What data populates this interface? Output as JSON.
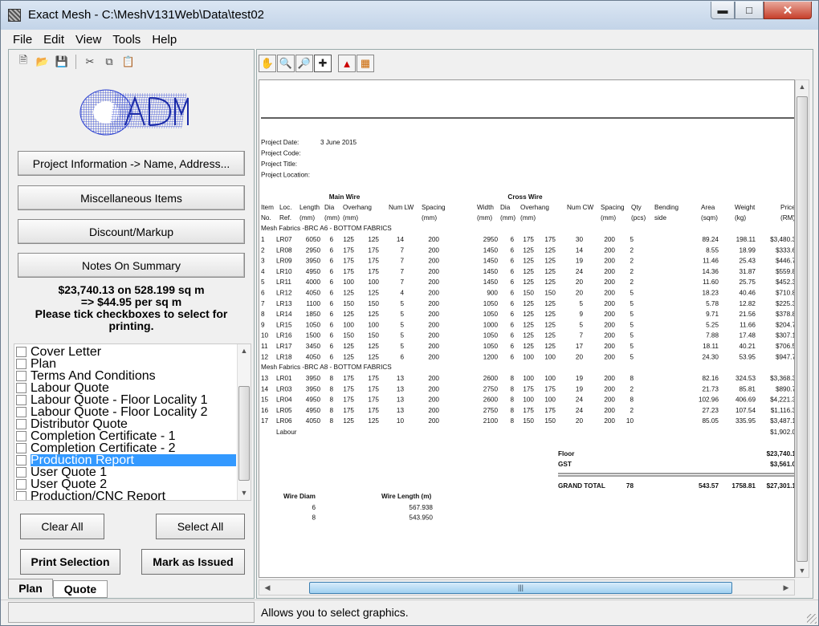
{
  "window": {
    "title": "Exact Mesh - C:\\MeshV131Web\\Data\\test02"
  },
  "menu": [
    "File",
    "Edit",
    "View",
    "Tools",
    "Help"
  ],
  "left": {
    "toolbar": [
      "new-icon",
      "open-icon",
      "save-icon",
      "cut-icon",
      "copy-icon",
      "paste-icon"
    ],
    "buttons": [
      "Project Information -> Name, Address...",
      "Miscellaneous Items",
      "Discount/Markup",
      "Notes On Summary"
    ],
    "summary": [
      "$23,740.13 on 528.199 sq m",
      "=>  $44.95 per sq m",
      "Please tick checkboxes to select for",
      "printing."
    ],
    "documents": [
      "Cover Letter",
      "Plan",
      "Terms And Conditions",
      "Labour Quote",
      "Labour Quote - Floor Locality 1",
      "Labour Quote - Floor Locality 2",
      "Distributor Quote",
      "Completion Certificate - 1",
      "Completion Certificate - 2",
      "Production Report",
      "User Quote 1",
      "User Quote 2",
      "Production/CNC Report"
    ],
    "selected_index": 9,
    "clear_all": "Clear All",
    "select_all": "Select All",
    "print_selection": "Print Selection",
    "mark_as_issued": "Mark as Issued",
    "tabs": [
      "Plan",
      "Quote"
    ],
    "active_tab": "Quote"
  },
  "right": {
    "tools": [
      "hand-icon",
      "zoom-in-icon",
      "zoom-out-icon",
      "crosshair-icon",
      "export-icon",
      "print-graphic-icon"
    ],
    "report": {
      "info": [
        {
          "label": "Project Date:",
          "value": "3 June 2015"
        },
        {
          "label": "Project Code:",
          "value": ""
        },
        {
          "label": "Project Title:",
          "value": ""
        },
        {
          "label": "Project Location:",
          "value": ""
        }
      ],
      "group_main": "Main Wire",
      "group_cross": "Cross Wire",
      "headers1": [
        "Item",
        "Loc.",
        "Length",
        "Dia",
        "Overhang",
        "Num LW",
        "Spacing",
        "Width",
        "Dia",
        "Overhang",
        "Num CW",
        "Spacing",
        "Qty",
        "Bending",
        "Area",
        "Weight",
        "Price"
      ],
      "headers2": [
        "No.",
        "Ref.",
        "(mm)",
        "(mm)",
        "(mm)",
        "",
        "(mm)",
        "(mm)",
        "(mm)",
        "(mm)",
        "",
        "(mm)",
        "(pcs)",
        "side",
        "(sqm)",
        "(kg)",
        "(RM)"
      ],
      "section1": "Mesh Fabrics -BRC A6 - BOTTOM FABRICS",
      "rows1": [
        [
          "1",
          "LR07",
          "6050",
          "6",
          "125",
          "125",
          "14",
          "200",
          "2950",
          "6",
          "175",
          "175",
          "30",
          "200",
          "5",
          "",
          "89.24",
          "198.11",
          "$3,480.3"
        ],
        [
          "2",
          "LR08",
          "2950",
          "6",
          "175",
          "175",
          "7",
          "200",
          "1450",
          "6",
          "125",
          "125",
          "14",
          "200",
          "2",
          "",
          "8.55",
          "18.99",
          "$333.6"
        ],
        [
          "3",
          "LR09",
          "3950",
          "6",
          "175",
          "175",
          "7",
          "200",
          "1450",
          "6",
          "125",
          "125",
          "19",
          "200",
          "2",
          "",
          "11.46",
          "25.43",
          "$446.7"
        ],
        [
          "4",
          "LR10",
          "4950",
          "6",
          "175",
          "175",
          "7",
          "200",
          "1450",
          "6",
          "125",
          "125",
          "24",
          "200",
          "2",
          "",
          "14.36",
          "31.87",
          "$559.8"
        ],
        [
          "5",
          "LR11",
          "4000",
          "6",
          "100",
          "100",
          "7",
          "200",
          "1450",
          "6",
          "125",
          "125",
          "20",
          "200",
          "2",
          "",
          "11.60",
          "25.75",
          "$452.3"
        ],
        [
          "6",
          "LR12",
          "4050",
          "6",
          "125",
          "125",
          "4",
          "200",
          "900",
          "6",
          "150",
          "150",
          "20",
          "200",
          "5",
          "",
          "18.23",
          "40.46",
          "$710.8"
        ],
        [
          "7",
          "LR13",
          "1100",
          "6",
          "150",
          "150",
          "5",
          "200",
          "1050",
          "6",
          "125",
          "125",
          "5",
          "200",
          "5",
          "",
          "5.78",
          "12.82",
          "$225.3"
        ],
        [
          "8",
          "LR14",
          "1850",
          "6",
          "125",
          "125",
          "5",
          "200",
          "1050",
          "6",
          "125",
          "125",
          "9",
          "200",
          "5",
          "",
          "9.71",
          "21.56",
          "$378.8"
        ],
        [
          "9",
          "LR15",
          "1050",
          "6",
          "100",
          "100",
          "5",
          "200",
          "1000",
          "6",
          "125",
          "125",
          "5",
          "200",
          "5",
          "",
          "5.25",
          "11.66",
          "$204.7"
        ],
        [
          "10",
          "LR16",
          "1500",
          "6",
          "150",
          "150",
          "5",
          "200",
          "1050",
          "6",
          "125",
          "125",
          "7",
          "200",
          "5",
          "",
          "7.88",
          "17.48",
          "$307.1"
        ],
        [
          "11",
          "LR17",
          "3450",
          "6",
          "125",
          "125",
          "5",
          "200",
          "1050",
          "6",
          "125",
          "125",
          "17",
          "200",
          "5",
          "",
          "18.11",
          "40.21",
          "$706.5"
        ],
        [
          "12",
          "LR18",
          "4050",
          "6",
          "125",
          "125",
          "6",
          "200",
          "1200",
          "6",
          "100",
          "100",
          "20",
          "200",
          "5",
          "",
          "24.30",
          "53.95",
          "$947.7"
        ]
      ],
      "section2": "Mesh Fabrics -BRC A8 - BOTTOM FABRICS",
      "rows2": [
        [
          "13",
          "LR01",
          "3950",
          "8",
          "175",
          "175",
          "13",
          "200",
          "2600",
          "8",
          "100",
          "100",
          "19",
          "200",
          "8",
          "",
          "82.16",
          "324.53",
          "$3,368.3"
        ],
        [
          "14",
          "LR03",
          "3950",
          "8",
          "175",
          "175",
          "13",
          "200",
          "2750",
          "8",
          "175",
          "175",
          "19",
          "200",
          "2",
          "",
          "21.73",
          "85.81",
          "$890.7"
        ],
        [
          "15",
          "LR04",
          "4950",
          "8",
          "175",
          "175",
          "13",
          "200",
          "2600",
          "8",
          "100",
          "100",
          "24",
          "200",
          "8",
          "",
          "102.96",
          "406.69",
          "$4,221.3"
        ],
        [
          "16",
          "LR05",
          "4950",
          "8",
          "175",
          "175",
          "13",
          "200",
          "2750",
          "8",
          "175",
          "175",
          "24",
          "200",
          "2",
          "",
          "27.23",
          "107.54",
          "$1,116.3"
        ],
        [
          "17",
          "LR06",
          "4050",
          "8",
          "125",
          "125",
          "10",
          "200",
          "2100",
          "8",
          "150",
          "150",
          "20",
          "200",
          "10",
          "",
          "85.05",
          "335.95",
          "$3,487.1"
        ]
      ],
      "labour_label": "Labour",
      "labour_value": "$1,902.0",
      "floor_label": "Floor",
      "floor_value": "$23,740.1",
      "gst_label": "GST",
      "gst_value": "$3,561.0",
      "grand_total_label": "GRAND TOTAL",
      "grand_qty": "78",
      "grand_area": "543.57",
      "grand_weight": "1758.81",
      "grand_price": "$27,301.1",
      "wire_headers": [
        "Wire Diam",
        "Wire Length (m)"
      ],
      "wire_rows": [
        [
          "6",
          "567.938"
        ],
        [
          "8",
          "543.950"
        ]
      ]
    }
  },
  "status": "Allows you to select graphics."
}
